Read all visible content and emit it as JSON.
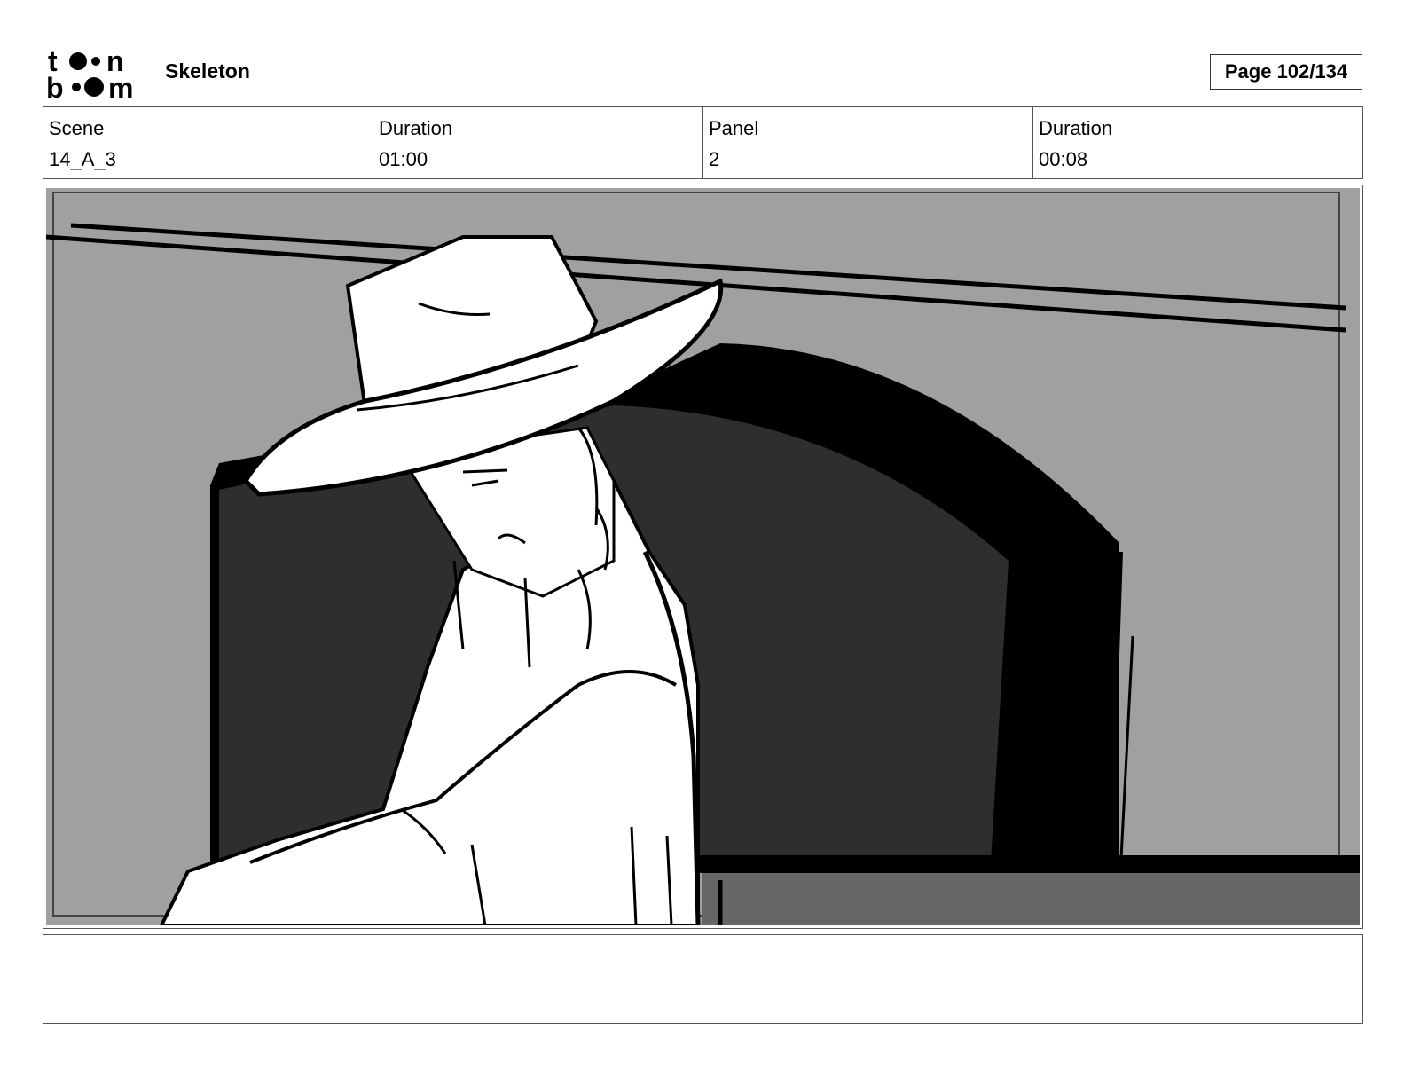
{
  "header": {
    "logo_text": "toon boom",
    "project_title": "Skeleton",
    "page_indicator": "Page 102/134"
  },
  "info": {
    "scene_label": "Scene",
    "scene_value": "14_A_3",
    "duration_label": "Duration",
    "duration_value": "01:00",
    "panel_label": "Panel",
    "panel_value": "2",
    "panel_duration_label": "Duration",
    "panel_duration_value": "00:08"
  },
  "panel": {
    "description": ""
  },
  "notes": {
    "text": ""
  },
  "colors": {
    "wall_gray": "#a0a0a0",
    "doorway_dark": "#2e2e2e",
    "ink": "#000000",
    "floor_gray": "#666666"
  }
}
